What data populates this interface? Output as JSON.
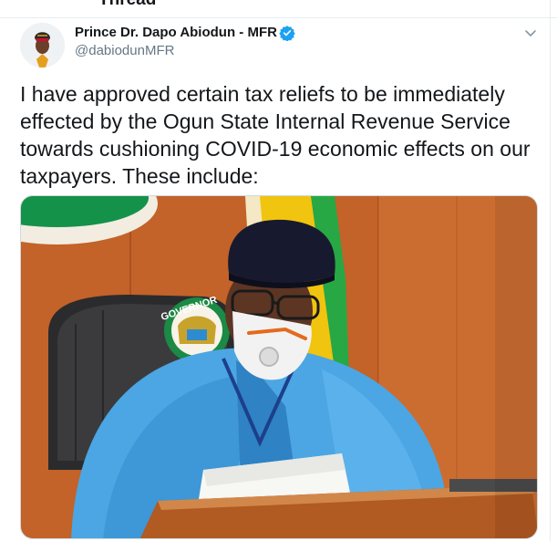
{
  "header": {
    "title": "Thread"
  },
  "tweet": {
    "author": {
      "name": "Prince Dr. Dapo Abiodun - MFR",
      "handle": "@dabiodunMFR",
      "verified": true
    },
    "text_lines": [
      "I have approved certain tax reliefs to be immediately",
      "effected by the Ogun State Internal Revenue Service",
      "towards cushioning COVID-19 economic effects on our",
      "taxpayers. These include:"
    ],
    "media": {
      "seal_text": "GOVERNOR"
    }
  },
  "colors": {
    "accent": "#1da1f2",
    "handle": "#657786",
    "text": "#14171a"
  },
  "icons": {
    "verified": "verified-badge-icon",
    "more": "chevron-down-icon"
  }
}
